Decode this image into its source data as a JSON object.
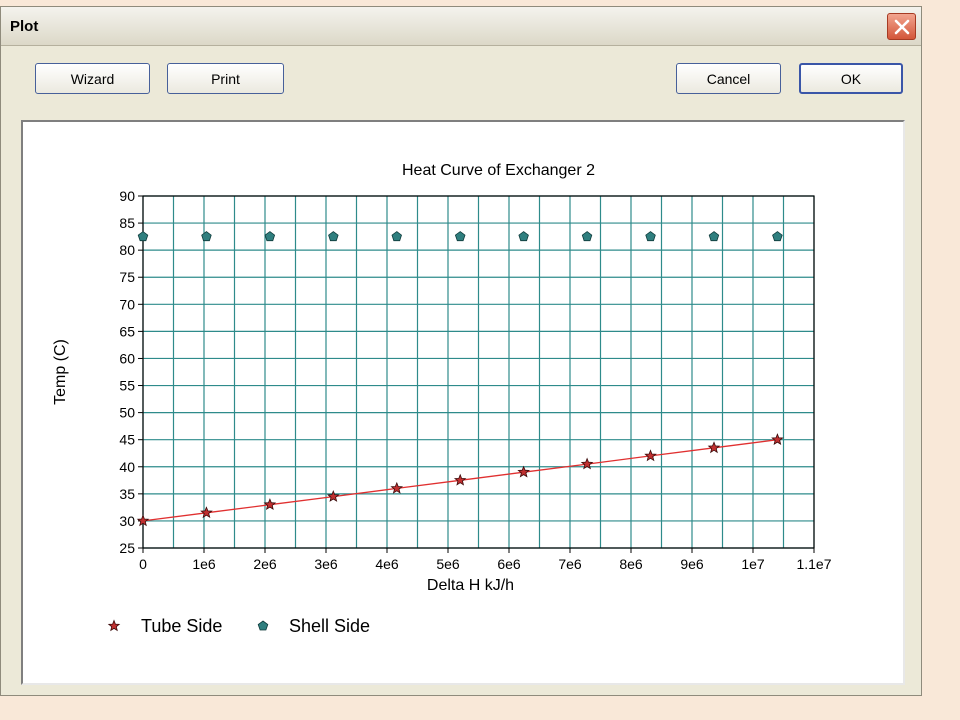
{
  "window": {
    "title": "Plot",
    "close_icon": "close-icon"
  },
  "buttons": {
    "wizard": "Wizard",
    "print": "Print",
    "cancel": "Cancel",
    "ok": "OK"
  },
  "colors": {
    "grid": "#2e8b8b",
    "tube_line": "#e03030",
    "tube_marker": "#c03030",
    "shell_marker": "#2f7f7f",
    "close_button": "#d3563a"
  },
  "chart_data": {
    "type": "scatter",
    "title": "Heat Curve of Exchanger 2",
    "xlabel": "Delta H kJ/h",
    "ylabel": "Temp (C)",
    "xlim": [
      0,
      11000000
    ],
    "ylim": [
      25,
      90
    ],
    "xticks": [
      0,
      1000000,
      2000000,
      3000000,
      4000000,
      5000000,
      6000000,
      7000000,
      8000000,
      9000000,
      10000000,
      11000000
    ],
    "xtick_labels": [
      "0",
      "1e6",
      "2e6",
      "3e6",
      "4e6",
      "5e6",
      "6e6",
      "7e6",
      "8e6",
      "9e6",
      "1e7",
      "1.1e7"
    ],
    "yticks": [
      25,
      30,
      35,
      40,
      45,
      50,
      55,
      60,
      65,
      70,
      75,
      80,
      85,
      90
    ],
    "grid": true,
    "legend_position": "bottom-left",
    "series": [
      {
        "name": "Tube Side",
        "marker": "star",
        "line": true,
        "x": [
          0,
          1040000,
          2080000,
          3120000,
          4160000,
          5200000,
          6240000,
          7280000,
          8320000,
          9360000,
          10400000
        ],
        "y": [
          30.0,
          31.5,
          33.0,
          34.5,
          36.0,
          37.5,
          39.0,
          40.5,
          42.0,
          43.5,
          45.0
        ]
      },
      {
        "name": "Shell Side",
        "marker": "pentagon",
        "line": false,
        "x": [
          0,
          1040000,
          2080000,
          3120000,
          4160000,
          5200000,
          6240000,
          7280000,
          8320000,
          9360000,
          10400000
        ],
        "y": [
          82.5,
          82.5,
          82.5,
          82.5,
          82.5,
          82.5,
          82.5,
          82.5,
          82.5,
          82.5,
          82.5
        ]
      }
    ]
  }
}
